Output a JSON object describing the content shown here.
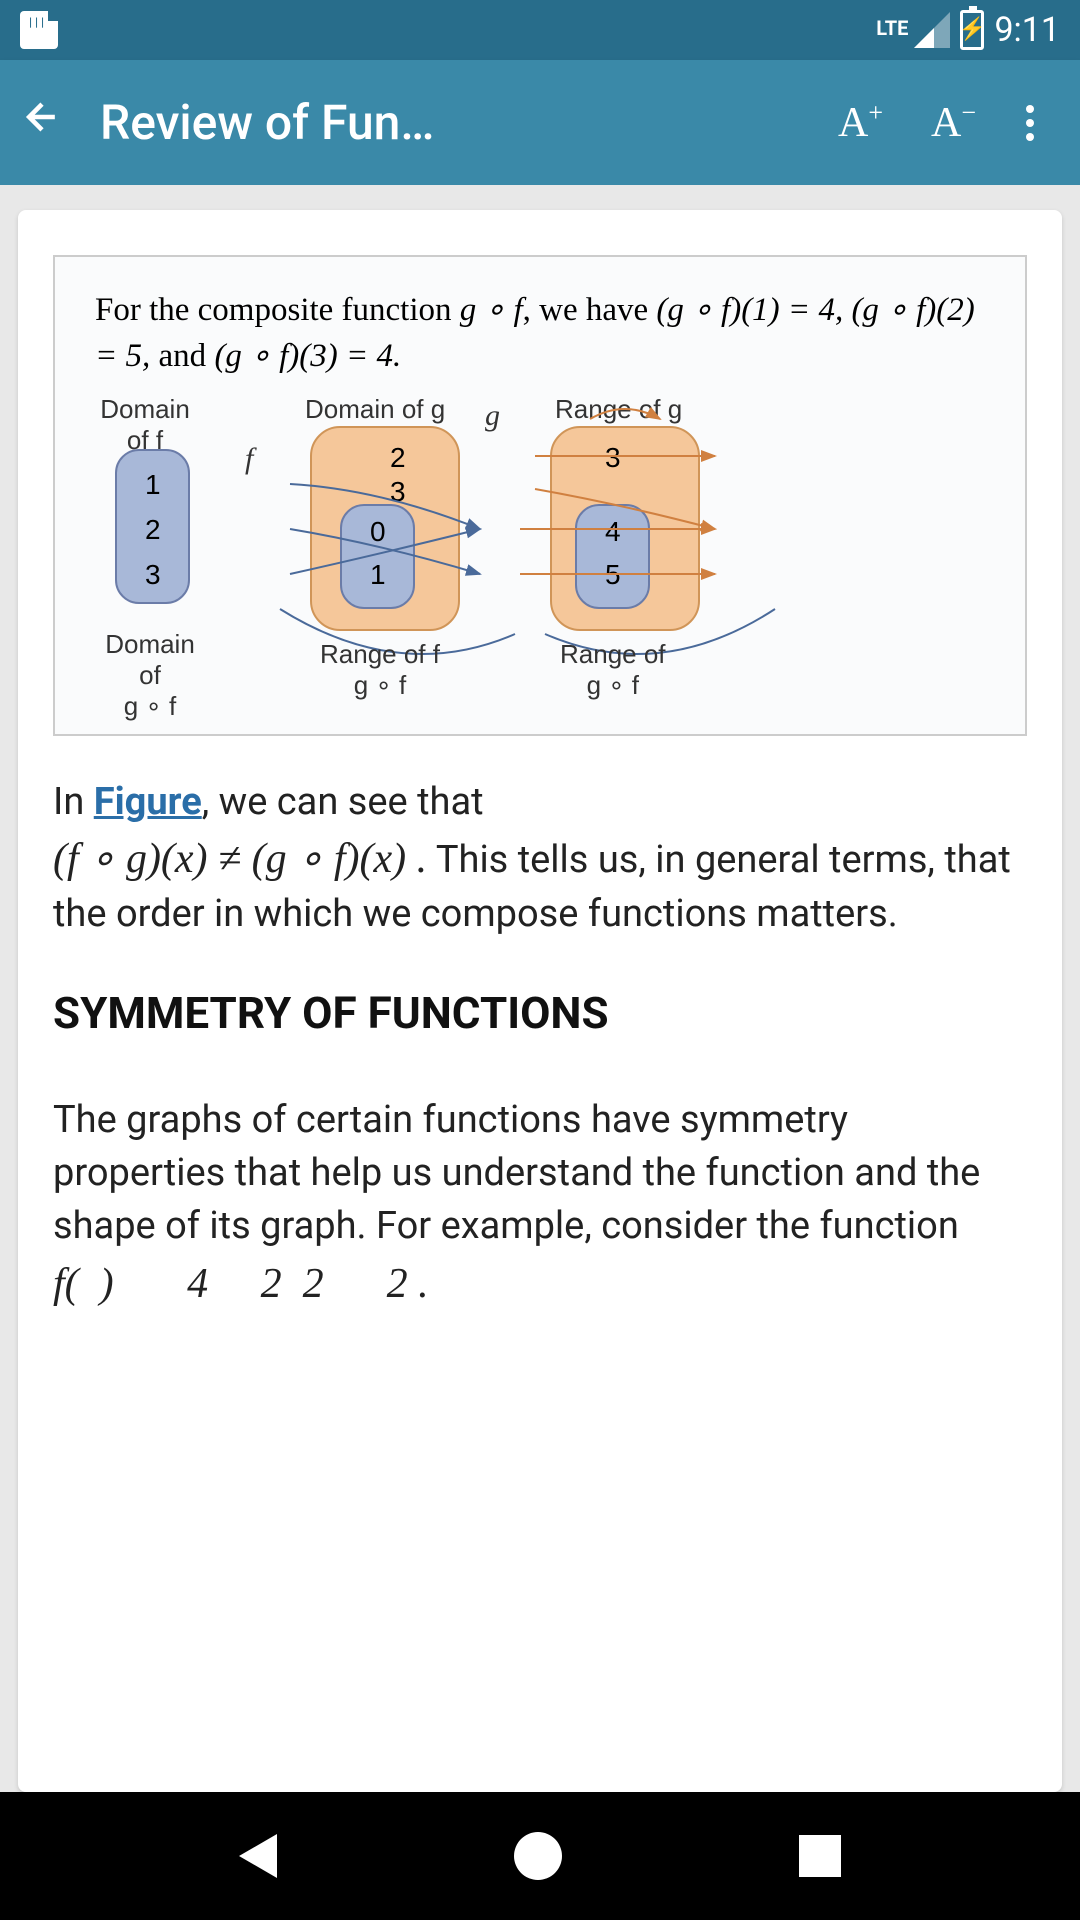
{
  "status": {
    "lte": "LTE",
    "time": "9:11"
  },
  "appbar": {
    "title": "Review of Fun…",
    "font_inc": "A",
    "font_inc_sup": "+",
    "font_dec": "A",
    "font_dec_sup": "−"
  },
  "figure": {
    "text_pre": "For the composite function ",
    "text_gof": "g ∘ f",
    "text_mid": ", we have ",
    "eq1": "(g ∘ f)(1) = 4, (g ∘ f)(2) = 5,",
    "text_and": " and ",
    "eq2": "(g ∘ f)(3) = 4.",
    "labels": {
      "domain_f": "Domain of f",
      "domain_g": "Domain of g",
      "range_g": "Range of g",
      "domain_gof_top": "Domain of",
      "domain_gof_bot": "g ∘ f",
      "range_f": "Range of f",
      "range_gof_bot": "g ∘ f",
      "range_gof_top": "Range of",
      "range_gof_bot2": "g ∘ f",
      "f": "f",
      "g": "g"
    },
    "nums": {
      "n1": "1",
      "n2": "2",
      "n3": "3",
      "m2": "2",
      "m3": "3",
      "m0": "0",
      "m1": "1",
      "r3": "3",
      "r4": "4",
      "r5": "5"
    }
  },
  "body": {
    "p1_pre": "In ",
    "p1_link": "Figure",
    "p1_mid": ", we can see that ",
    "p1_eq": "(f ∘ g)(x) ≠ (g ∘ f)(x) .",
    "p1_end": " This tells us, in general terms, that the order in which we compose functions matters.",
    "h2": "SYMMETRY OF FUNCTIONS",
    "p2": "The graphs of certain functions have symmetry properties that help us understand the function and the shape of its graph. For example, consider the function",
    "cutoff": "f(  )       4     2  2      2 ."
  }
}
